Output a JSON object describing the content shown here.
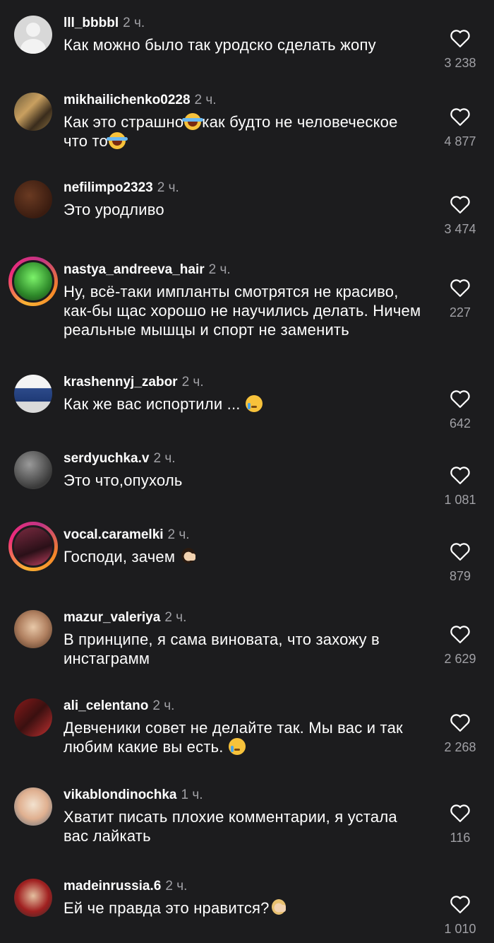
{
  "comments": [
    {
      "username": "lll_bbbbl",
      "time": "2 ч.",
      "text": "Как можно было так уродско сделать жопу",
      "likes": "3 238"
    },
    {
      "username": "mikhailichenko0228",
      "time": "2 ч.",
      "text_parts": [
        "Как это страшно",
        "как будто не человеческое что то"
      ],
      "likes": "4 877"
    },
    {
      "username": "nefilimpo2323",
      "time": "2 ч.",
      "text": "Это уродливо",
      "likes": "3 474"
    },
    {
      "username": "nastya_andreeva_hair",
      "time": "2 ч.",
      "text": "Ну, всё-таки импланты смотрятся не красиво, как-бы щас хорошо не научились делать. Ничем реальные мышцы и спорт не заменить",
      "likes": "227"
    },
    {
      "username": "krashennyj_zabor",
      "time": "2 ч.",
      "text": "Как же вас испортили ...",
      "likes": "642"
    },
    {
      "username": "serdyuchka.v",
      "time": "2 ч.",
      "text": "Это что,опухоль",
      "likes": "1 081"
    },
    {
      "username": "vocal.caramelki",
      "time": "2 ч.",
      "text": "Господи, зачем",
      "likes": "879"
    },
    {
      "username": "mazur_valeriya",
      "time": "2 ч.",
      "text": "В принципе, я сама виновата, что захожу в инстаграмм",
      "likes": "2 629"
    },
    {
      "username": "ali_celentano",
      "time": "2 ч.",
      "text": "Девченики совет не делайте так. Мы вас и так любим какие вы есть.",
      "likes": "2 268"
    },
    {
      "username": "vikablondinochka",
      "time": "1 ч.",
      "text": "Хватит писать плохие комментарии, я устала вас лайкать",
      "likes": "116"
    },
    {
      "username": "madeinrussia.6",
      "time": "2 ч.",
      "text": "Ей че правда это нравится?",
      "likes": "1 010"
    }
  ],
  "icons": {
    "like": "heart-outline-icon",
    "emoji_laugh": "face-with-tears-of-joy",
    "emoji_cry": "crying-face",
    "emoji_facepalm": "person-facepalming"
  },
  "colors": {
    "background": "#1c1c1e",
    "text": "#ffffff",
    "secondary": "#a0a0a5"
  }
}
